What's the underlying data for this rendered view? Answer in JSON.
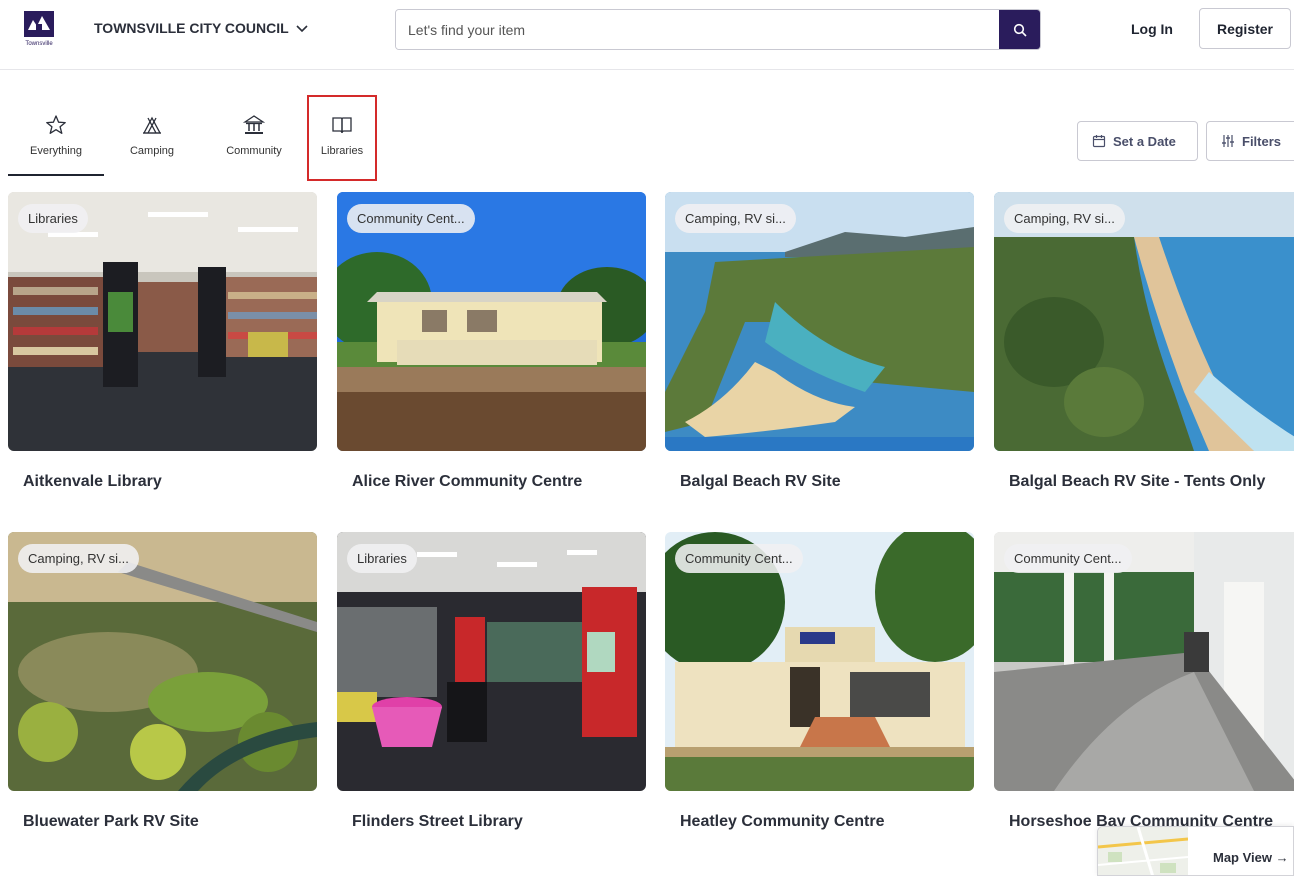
{
  "header": {
    "council_name": "TOWNSVILLE CITY COUNCIL",
    "logo_text": "Townsville",
    "search_placeholder": "Let's find your item",
    "login_label": "Log In",
    "register_label": "Register"
  },
  "tabs": [
    {
      "label": "Everything",
      "icon": "star-icon"
    },
    {
      "label": "Camping",
      "icon": "tent-icon"
    },
    {
      "label": "Community",
      "icon": "building-icon"
    },
    {
      "label": "Libraries",
      "icon": "book-icon"
    }
  ],
  "actions": {
    "set_date_label": "Set a Date",
    "filters_label": "Filters"
  },
  "cards": [
    {
      "badge": "Libraries",
      "title": "Aitkenvale Library"
    },
    {
      "badge": "Community Cent...",
      "title": "Alice River Community Centre"
    },
    {
      "badge": "Camping, RV si...",
      "title": "Balgal Beach RV Site"
    },
    {
      "badge": "Camping, RV si...",
      "title": "Balgal Beach RV Site - Tents Only"
    },
    {
      "badge": "Camping, RV si...",
      "title": "Bluewater Park RV Site"
    },
    {
      "badge": "Libraries",
      "title": "Flinders Street Library"
    },
    {
      "badge": "Community Cent...",
      "title": "Heatley Community Centre"
    },
    {
      "badge": "Community Cent...",
      "title": "Horseshoe Bay Community Centre"
    }
  ],
  "map_view": {
    "label": "Map View →"
  },
  "colors": {
    "accent": "#2a1c5c",
    "highlight": "#d42a2a"
  }
}
